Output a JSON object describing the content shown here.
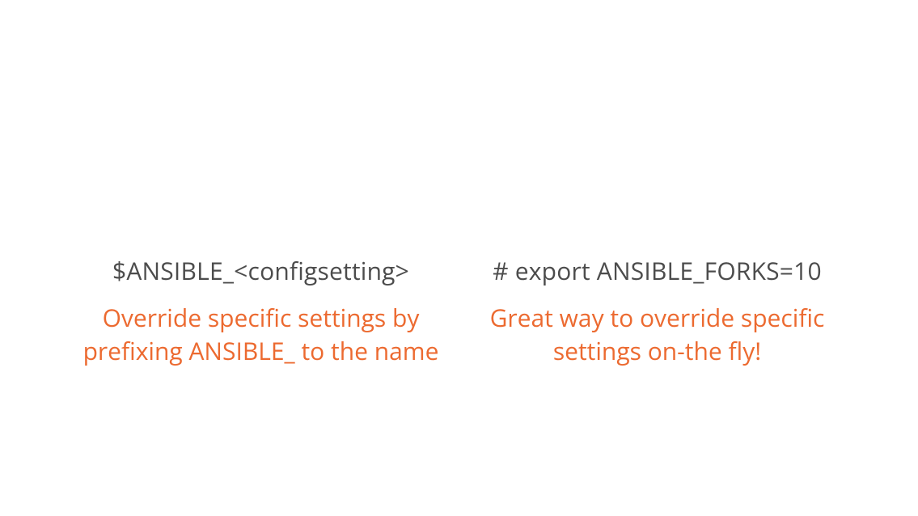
{
  "columns": [
    {
      "heading": "$ANSIBLE_<configsetting>",
      "description": "Override specific settings by prefixing ANSIBLE_ to the name"
    },
    {
      "heading": "# export ANSIBLE_FORKS=10",
      "description": "Great way to override specific settings on-the fly!"
    }
  ]
}
